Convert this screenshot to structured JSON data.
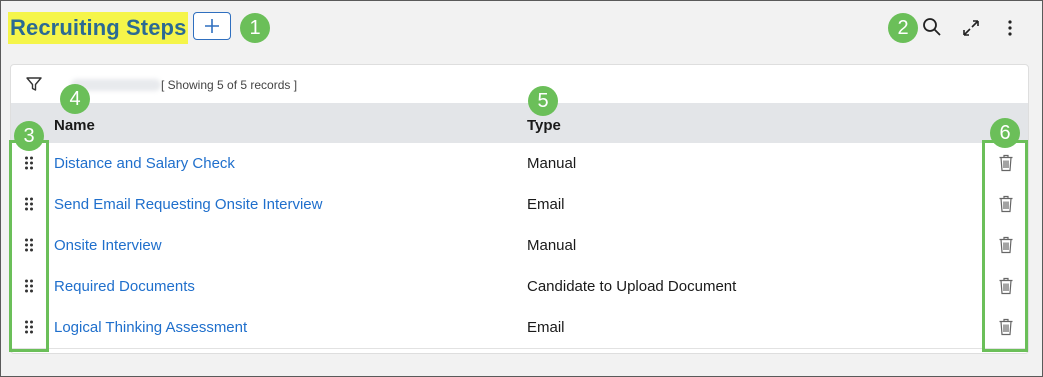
{
  "header": {
    "title": "Recruiting Steps",
    "add_icon": "plus-icon",
    "search_icon": "search-icon",
    "expand_icon": "expand-icon",
    "more_icon": "more-vertical-icon"
  },
  "toolbar": {
    "filter_icon": "filter-icon",
    "record_count": "[ Showing 5 of 5 records ]"
  },
  "table": {
    "columns": [
      "Name",
      "Type"
    ],
    "rows": [
      {
        "name": "Distance and Salary Check",
        "type": "Manual"
      },
      {
        "name": "Send Email Requesting Onsite Interview",
        "type": "Email"
      },
      {
        "name": "Onsite Interview",
        "type": "Manual"
      },
      {
        "name": "Required Documents",
        "type": "Candidate to Upload Document"
      },
      {
        "name": "Logical Thinking Assessment",
        "type": "Email"
      }
    ]
  },
  "callouts": [
    "1",
    "2",
    "3",
    "4",
    "5",
    "6"
  ],
  "colors": {
    "title_highlight": "#f5f54a",
    "title_text": "#2b6a93",
    "link": "#1f6fcc",
    "callout": "#6bbf59",
    "header_bg": "#e3e5e8"
  }
}
